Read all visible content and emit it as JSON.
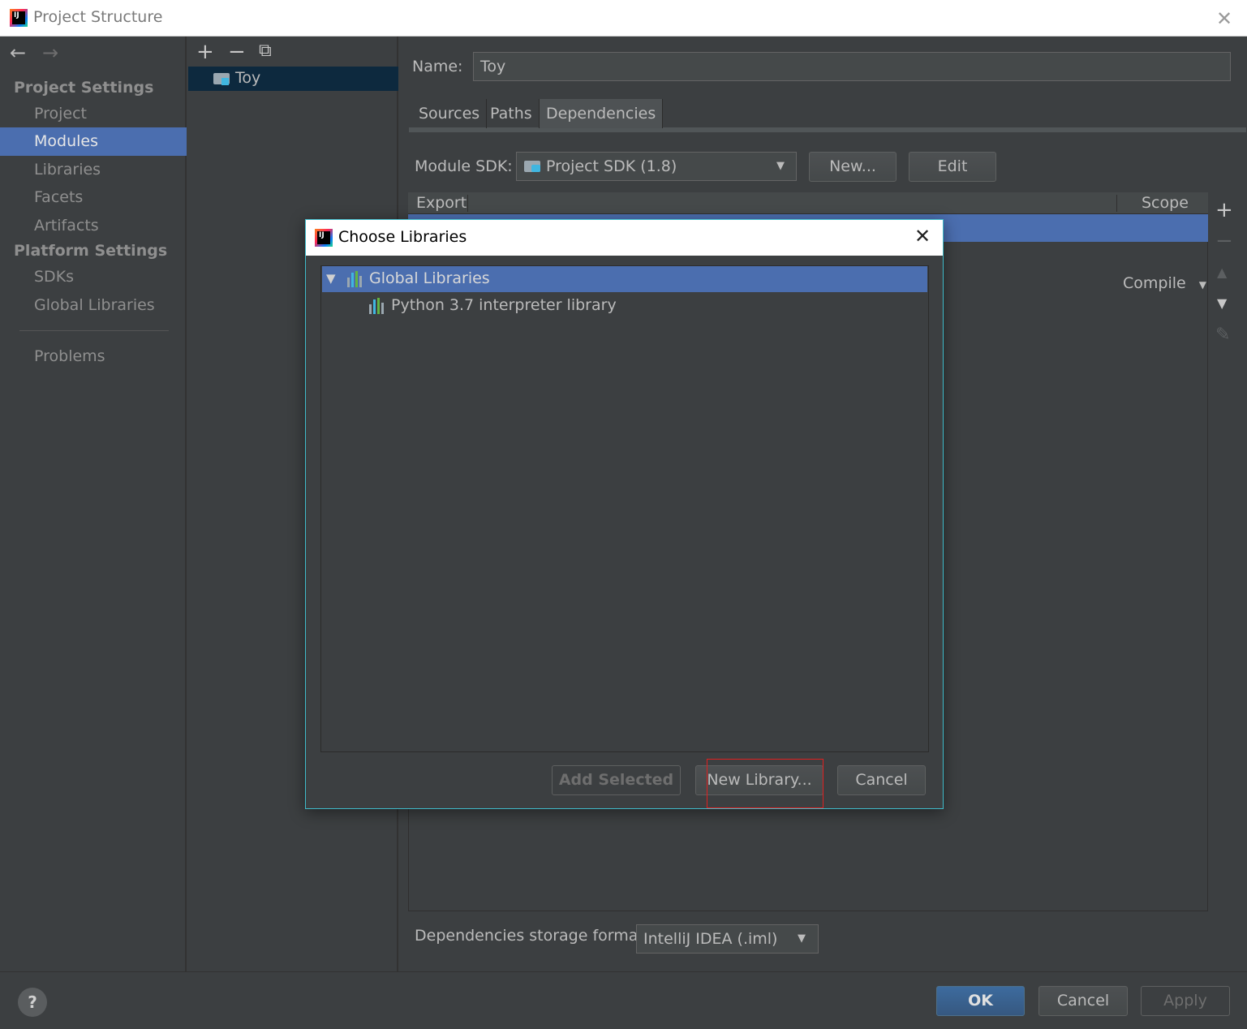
{
  "window": {
    "title": "Project Structure",
    "close_glyph": "✕"
  },
  "nav": {
    "back_glyph": "←",
    "forward_glyph": "→",
    "project_settings_header": "Project Settings",
    "platform_settings_header": "Platform Settings",
    "items": {
      "project": "Project",
      "modules": "Modules",
      "libraries": "Libraries",
      "facets": "Facets",
      "artifacts": "Artifacts",
      "sdks": "SDKs",
      "global_libraries": "Global Libraries",
      "problems": "Problems"
    },
    "selected": "Modules"
  },
  "modules_toolbar": {
    "add_glyph": "+",
    "remove_glyph": "−",
    "copy_glyph": "⧉"
  },
  "module_tree": {
    "module_name": "Toy"
  },
  "module_panel": {
    "name_label": "Name:",
    "name_value": "Toy",
    "tabs": {
      "sources": "Sources",
      "paths": "Paths",
      "dependencies": "Dependencies"
    },
    "selected_tab": "Dependencies",
    "sdk_label": "Module SDK:",
    "sdk_value": "Project SDK (1.8)",
    "new_button": "New...",
    "edit_button": "Edit",
    "table": {
      "col_export": "Export",
      "col_scope": "Scope",
      "row_scope": "Compile"
    },
    "side_tools": {
      "add_glyph": "+",
      "remove_glyph": "−",
      "up_glyph": "▲",
      "down_glyph": "▼",
      "edit_glyph": "✎"
    },
    "storage_label": "Dependencies storage format:",
    "storage_value": "IntelliJ IDEA (.iml)"
  },
  "footer": {
    "help_glyph": "?",
    "ok_button": "OK",
    "cancel_button": "Cancel",
    "apply_button": "Apply"
  },
  "dialog": {
    "title": "Choose Libraries",
    "close_glyph": "✕",
    "tree": {
      "group_label": "Global Libraries",
      "library_label": "Python 3.7 interpreter library"
    },
    "add_selected_button": "Add Selected",
    "new_library_button": "New Library...",
    "cancel_button": "Cancel"
  },
  "colors": {
    "accent": "#4b6eaf",
    "dialog_border": "#3fbac9",
    "highlight_box": "#e02020",
    "background": "#3c3f41"
  }
}
